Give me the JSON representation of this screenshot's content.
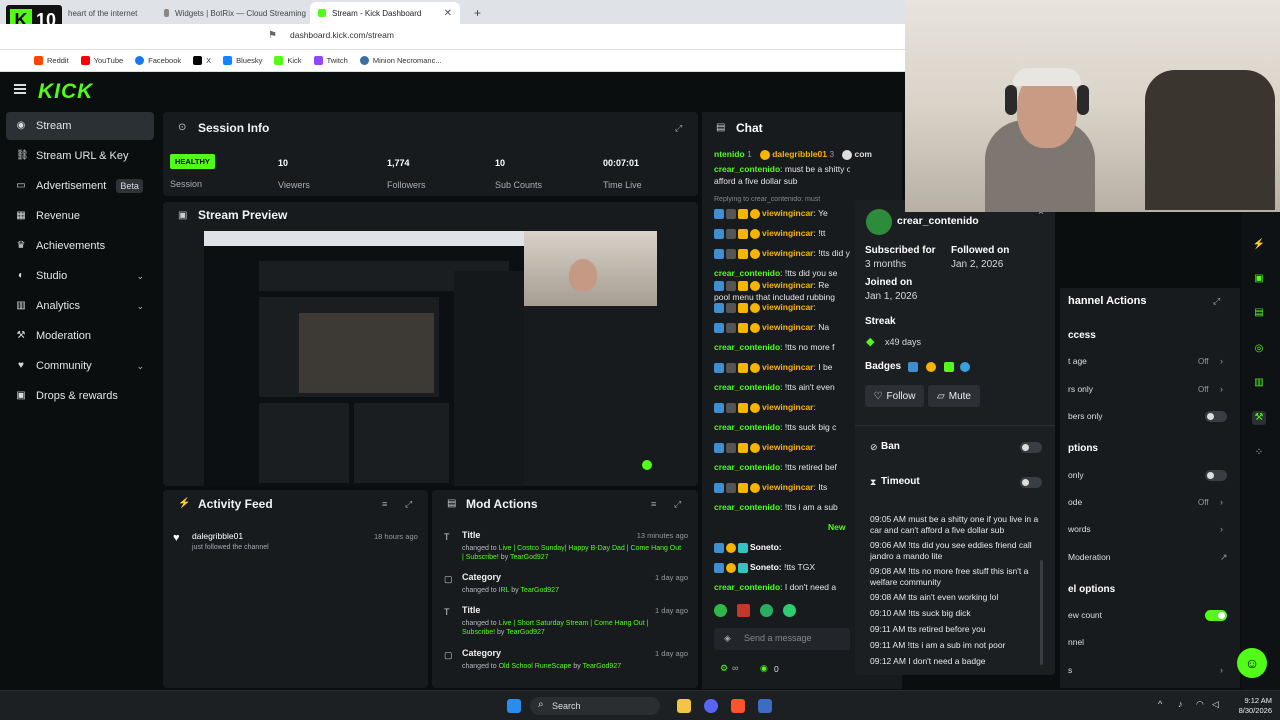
{
  "browser": {
    "tabs": [
      {
        "label": "heart of the internet"
      },
      {
        "label": "Widgets | BotRix — Cloud Streaming"
      },
      {
        "label": "Stream - Kick Dashboard"
      }
    ],
    "url": "dashboard.kick.com/stream",
    "bookmarks": [
      "Reddit",
      "YouTube",
      "Facebook",
      "X",
      "Bluesky",
      "Kick",
      "Twitch",
      "Minion Necromanc..."
    ],
    "overlay_badge": "10"
  },
  "app": {
    "logo": "KICK",
    "sidebar": [
      {
        "label": "Stream",
        "icon": "stream-icon"
      },
      {
        "label": "Stream URL & Key",
        "icon": "link-icon"
      },
      {
        "label": "Advertisement",
        "badge": "Beta",
        "icon": "ad-icon"
      },
      {
        "label": "Revenue",
        "icon": "revenue-icon"
      },
      {
        "label": "Achievements",
        "icon": "trophy-icon"
      },
      {
        "label": "Studio",
        "icon": "studio-icon",
        "chevron": "⌄"
      },
      {
        "label": "Analytics",
        "icon": "analytics-icon",
        "chevron": "⌄"
      },
      {
        "label": "Moderation",
        "icon": "moderation-icon"
      },
      {
        "label": "Community",
        "icon": "community-icon",
        "chevron": "⌄"
      },
      {
        "label": "Drops & rewards",
        "icon": "gift-icon"
      }
    ]
  },
  "session": {
    "title": "Session Info",
    "health": "HEALTHY",
    "health_label": "Session",
    "stats": [
      {
        "value": "10",
        "label": "Viewers"
      },
      {
        "value": "1,774",
        "label": "Followers"
      },
      {
        "value": "10",
        "label": "Sub Counts"
      },
      {
        "value": "00:07:01",
        "label": "Time Live"
      }
    ]
  },
  "preview": {
    "title": "Stream Preview"
  },
  "activity": {
    "title": "Activity Feed",
    "items": [
      {
        "name": "dalegribble01",
        "sub": "just followed the channel",
        "time": "18 hours ago"
      }
    ]
  },
  "mod_actions": {
    "title": "Mod Actions",
    "items": [
      {
        "title": "Title",
        "time": "13 minutes ago",
        "pre": "changed to",
        "value": "Live | Costco Sunday| Happy B-Day Dad | Come Hang Out | Subscribe!",
        "by": "by",
        "who": "TearGod927"
      },
      {
        "title": "Category",
        "time": "1 day ago",
        "pre": "changed to",
        "value": "IRL",
        "by": "by",
        "who": "TearGod927"
      },
      {
        "title": "Title",
        "time": "1 day ago",
        "pre": "changed to",
        "value": "Live | Short Saturday Stream | Come Hang Out | Subscribe!",
        "by": "by",
        "who": "TearGod927"
      },
      {
        "title": "Category",
        "time": "1 day ago",
        "pre": "changed to",
        "value": "Old School RuneScape",
        "by": "by",
        "who": "TearGod927"
      }
    ]
  },
  "chat": {
    "title": "Chat",
    "pinned": [
      {
        "user": "ntenido",
        "count": "1"
      },
      {
        "user": "dalegribble01",
        "count": "3"
      },
      {
        "user": "com",
        "count": ""
      }
    ],
    "messages": [
      {
        "user": "crear_contenido",
        "text": "must be a shitty one if you li",
        "style": "u"
      },
      {
        "user": "",
        "text": "afford a five dollar sub",
        "style": "plain"
      },
      {
        "user": "",
        "text": "Replying to crear_contenido: must",
        "style": "reply"
      },
      {
        "user": "viewingincar",
        "text": "Ye",
        "style": "o"
      },
      {
        "user": "viewingincar",
        "text": "!tt",
        "style": "o"
      },
      {
        "user": "viewingincar",
        "text": "!tts did you se",
        "style": "o"
      },
      {
        "user": "crear_contenido",
        "text": "!tts did you se",
        "style": "u"
      },
      {
        "user": "viewingincar",
        "text": "Re",
        "style": "o"
      },
      {
        "user": "",
        "text": "pool menu that included rubbing",
        "style": "plain"
      },
      {
        "user": "viewingincar",
        "text": "",
        "style": "o"
      },
      {
        "user": "viewingincar",
        "text": "Na",
        "style": "o"
      },
      {
        "user": "crear_contenido",
        "text": "!tts no more f",
        "style": "u"
      },
      {
        "user": "viewingincar",
        "text": "I be",
        "style": "o"
      },
      {
        "user": "crear_contenido",
        "text": "!tts ain't even",
        "style": "u"
      },
      {
        "user": "viewingincar",
        "text": "",
        "style": "o"
      },
      {
        "user": "crear_contenido",
        "text": "!tts suck big c",
        "style": "u"
      },
      {
        "user": "viewingincar",
        "text": "",
        "style": "o"
      },
      {
        "user": "crear_contenido",
        "text": "!tts retired bef",
        "style": "u"
      },
      {
        "user": "viewingincar",
        "text": "Its",
        "style": "o"
      },
      {
        "user": "crear_contenido",
        "text": "!tts i am a sub",
        "style": "u"
      }
    ],
    "new_label": "New",
    "soneto": [
      {
        "user": "Soneto:",
        "text": ""
      },
      {
        "user": "Soneto:",
        "text": "!tts TGX"
      }
    ],
    "last": {
      "user": "crear_contenido",
      "text": "I don't need a"
    },
    "input_placeholder": "Send a message",
    "viewer_count": "0"
  },
  "popup": {
    "username": "crear_contenido",
    "subscribed_for_label": "Subscribed for",
    "subscribed_for": "3 months",
    "followed_on_label": "Followed on",
    "followed_on": "Jan 2, 2026",
    "joined_on_label": "Joined on",
    "joined_on": "Jan 1, 2026",
    "streak_label": "Streak",
    "streak": "x49 days",
    "badges_label": "Badges",
    "follow": "Follow",
    "mute": "Mute",
    "ban": "Ban",
    "timeout": "Timeout",
    "log": [
      "09:05 AM must be a shitty one if you live in a car and can't afford a five dollar sub",
      "09:06 AM !tts did you see eddies friend call jandro a mando lite",
      "09:08 AM !tts no more free stuff this isn't a welfare community",
      "09:08 AM tts ain't even working lol",
      "09:10 AM !tts suck big dick",
      "09:11 AM tts retired before you",
      "09:11 AM !tts i am a sub im not poor",
      "09:12 AM I don't need a badge"
    ]
  },
  "channel_actions": {
    "title": "hannel Actions",
    "rows": [
      {
        "label": "ccess",
        "style": "h"
      },
      {
        "label": "t age",
        "value": "Off",
        "chev": "›"
      },
      {
        "label": "rs only",
        "value": "Off",
        "chev": "›"
      },
      {
        "label": "bers only",
        "toggle": "off"
      },
      {
        "label": "ptions",
        "style": "h"
      },
      {
        "label": "only",
        "toggle": "off"
      },
      {
        "label": "ode",
        "value": "Off",
        "chev": "›"
      },
      {
        "label": "words",
        "chev": "›"
      },
      {
        "label": "Moderation",
        "chev": "↗"
      },
      {
        "label": "el options",
        "style": "h"
      },
      {
        "label": "ew count",
        "toggle": "on"
      },
      {
        "label": "nnel"
      },
      {
        "label": "s",
        "chev": "›"
      }
    ]
  },
  "taskbar": {
    "search": "Search",
    "time": "9:12 AM",
    "date": "8/30/2026"
  },
  "colors": {
    "accent": "#53fc18",
    "panel": "#181b1e",
    "bg": "#0b0e0f",
    "owner": "#f7b500"
  }
}
